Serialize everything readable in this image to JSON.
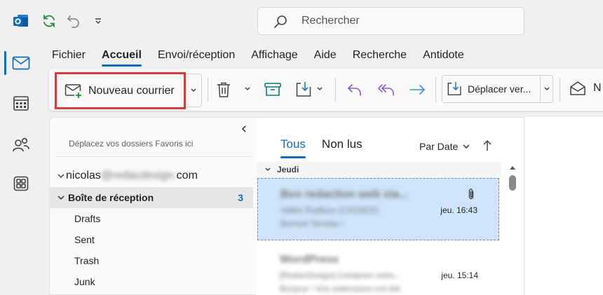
{
  "search": {
    "placeholder": "Rechercher"
  },
  "menu": {
    "tabs": [
      {
        "label": "Fichier",
        "active": false
      },
      {
        "label": "Accueil",
        "active": true
      },
      {
        "label": "Envoi/réception",
        "active": false
      },
      {
        "label": "Affichage",
        "active": false
      },
      {
        "label": "Aide",
        "active": false
      },
      {
        "label": "Recherche",
        "active": false
      },
      {
        "label": "Antidote",
        "active": false
      }
    ]
  },
  "ribbon": {
    "new_mail_label": "Nouveau courrier",
    "move_label": "Déplacer ver...",
    "last_label": "N"
  },
  "folders": {
    "favorites_hint": "Déplacez vos dossiers Favoris ici",
    "account": {
      "prefix": "nicolas",
      "hidden": "@redacdesign.",
      "suffix": "com"
    },
    "items": [
      {
        "label": "Boîte de réception",
        "count": "3",
        "selected": true
      },
      {
        "label": "Drafts",
        "count": "",
        "selected": false
      },
      {
        "label": "Sent",
        "count": "",
        "selected": false
      },
      {
        "label": "Trash",
        "count": "",
        "selected": false
      },
      {
        "label": "Junk",
        "count": "",
        "selected": false
      }
    ]
  },
  "messages": {
    "tabs": [
      {
        "label": "Tous",
        "active": true
      },
      {
        "label": "Non lus",
        "active": false
      }
    ],
    "sort_label": "Par Date",
    "group_label": "Jeudi",
    "items": [
      {
        "sender": "Bvo redaction web via...",
        "subject": "Valkie Radlase (CASSER)",
        "preview": "Bonsoir Nicolas !",
        "time": "jeu. 16:43",
        "attachment": true,
        "selected": true
      },
      {
        "sender": "WordPress",
        "subject": "[RedacDesign] Certaines votre...",
        "preview": "Bonjour ! Vos extensions ont été",
        "time": "jeu. 15:14",
        "attachment": false,
        "selected": false
      }
    ]
  },
  "colors": {
    "accent": "#0f6cbd",
    "highlight": "#d83b3b",
    "selection": "#cfe4fa",
    "purple_icons": "#8b5cc8",
    "teal_icons": "#0b7a75"
  }
}
